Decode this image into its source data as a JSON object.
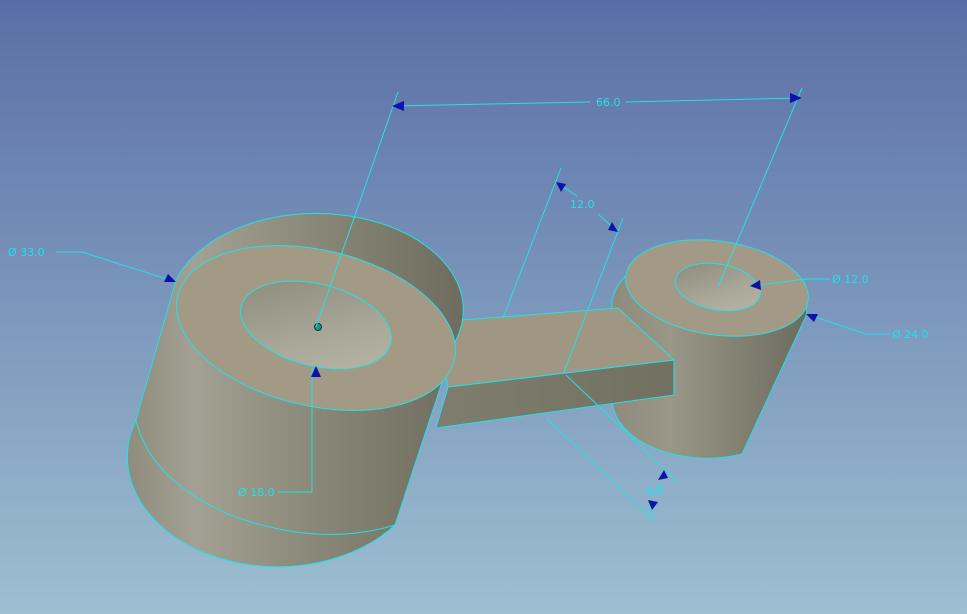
{
  "colors": {
    "background_top": "#5b6fa5",
    "background_bottom": "#9bbccf",
    "part_top": "#a39a86",
    "part_side_light": "#9c9888",
    "part_side_dark": "#6e6d5f",
    "edge": "#1ee3e8",
    "arrow": "#0a14a8"
  },
  "dimensions": {
    "center_distance": "66.0",
    "arm_width": "12.0",
    "arm_height": "6.0",
    "big_outer_dia": "Ø 33.0",
    "big_inner_dia": "Ø 18.0",
    "small_inner_dia": "Ø 12.0",
    "small_outer_dia": "Ø 24.0"
  }
}
